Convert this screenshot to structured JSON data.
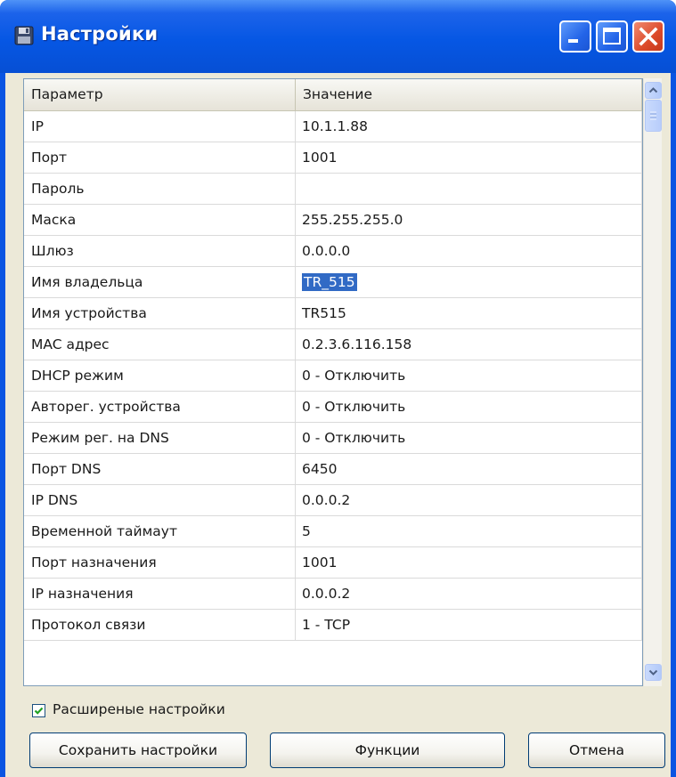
{
  "window": {
    "title": "Настройки",
    "icon": "floppy-disk-icon",
    "controls": [
      "minimize-icon",
      "maximize-icon",
      "close-icon"
    ]
  },
  "grid": {
    "columns": [
      "Параметр",
      "Значение"
    ],
    "rows": [
      {
        "param": "IP",
        "value": "10.1.1.88"
      },
      {
        "param": "Порт",
        "value": "1001"
      },
      {
        "param": "Пароль",
        "value": ""
      },
      {
        "param": "Маска",
        "value": "255.255.255.0"
      },
      {
        "param": "Шлюз",
        "value": "0.0.0.0"
      },
      {
        "param": "Имя владельца",
        "value": "TR_515"
      },
      {
        "param": "Имя устройства",
        "value": "TR515"
      },
      {
        "param": "MAC адрес",
        "value": "0.2.3.6.116.158"
      },
      {
        "param": "DHCP режим",
        "value": "0 - Отключить"
      },
      {
        "param": "Авторег. устройства",
        "value": "0 - Отключить"
      },
      {
        "param": "Режим рег. на DNS",
        "value": "0 - Отключить"
      },
      {
        "param": "Порт DNS",
        "value": "6450"
      },
      {
        "param": "IP DNS",
        "value": "0.0.0.2"
      },
      {
        "param": "Временной таймаут",
        "value": "5"
      },
      {
        "param": "Порт назначения",
        "value": "1001"
      },
      {
        "param": "IP назначения",
        "value": "0.0.0.2"
      },
      {
        "param": "Протокол связи",
        "value": "1 - TCP"
      }
    ],
    "selected_row": "Имя владельца"
  },
  "extended_settings": {
    "label": "Расширеные настройки",
    "checked": true
  },
  "buttons": {
    "save": "Сохранить настройки",
    "functions": "Функции",
    "cancel": "Отмена"
  },
  "colors": {
    "titlebar": "#0657e4",
    "selection": "#316ac5",
    "dialog_bg": "#ece9d8"
  }
}
